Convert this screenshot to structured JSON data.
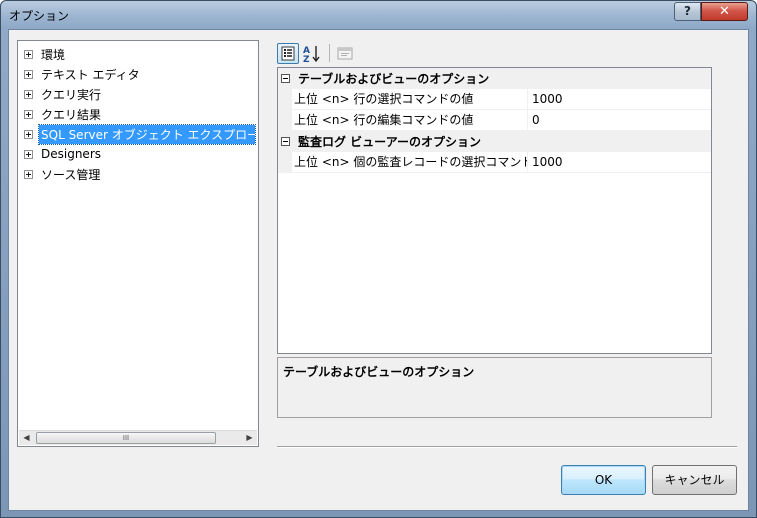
{
  "window": {
    "title": "オプション",
    "help_label": "?",
    "close_label": "✕"
  },
  "tree": {
    "items": [
      {
        "label": "環境"
      },
      {
        "label": "テキスト エディタ"
      },
      {
        "label": "クエリ実行"
      },
      {
        "label": "クエリ結果"
      },
      {
        "label": "SQL Server オブジェクト エクスプローラー"
      },
      {
        "label": "Designers"
      },
      {
        "label": "ソース管理"
      }
    ],
    "selected_index": 4,
    "scroll_left": "◀",
    "scroll_right": "▶",
    "scroll_grip": "III"
  },
  "toolbar": {
    "categorized_icon": "categorized-icon",
    "alphabetical_icon": "sort-az-icon",
    "property_pages_icon": "property-pages-icon"
  },
  "propgrid": {
    "categories": [
      {
        "name": "テーブルおよびビューのオプション",
        "rows": [
          {
            "name": "上位 <n> 行の選択コマンドの値",
            "value": "1000"
          },
          {
            "name": "上位 <n> 行の編集コマンドの値",
            "value": "0"
          }
        ]
      },
      {
        "name": "監査ログ ビューアーのオプション",
        "rows": [
          {
            "name": "上位 <n> 個の監査レコードの選択コマンドの値",
            "value": "1000"
          }
        ]
      }
    ]
  },
  "description": {
    "title": "テーブルおよびビューのオプション"
  },
  "buttons": {
    "ok": "OK",
    "cancel": "キャンセル"
  },
  "colors": {
    "selection": "#3399ff",
    "title_bar": "#9ab3cf",
    "close_button": "#c1392b"
  }
}
